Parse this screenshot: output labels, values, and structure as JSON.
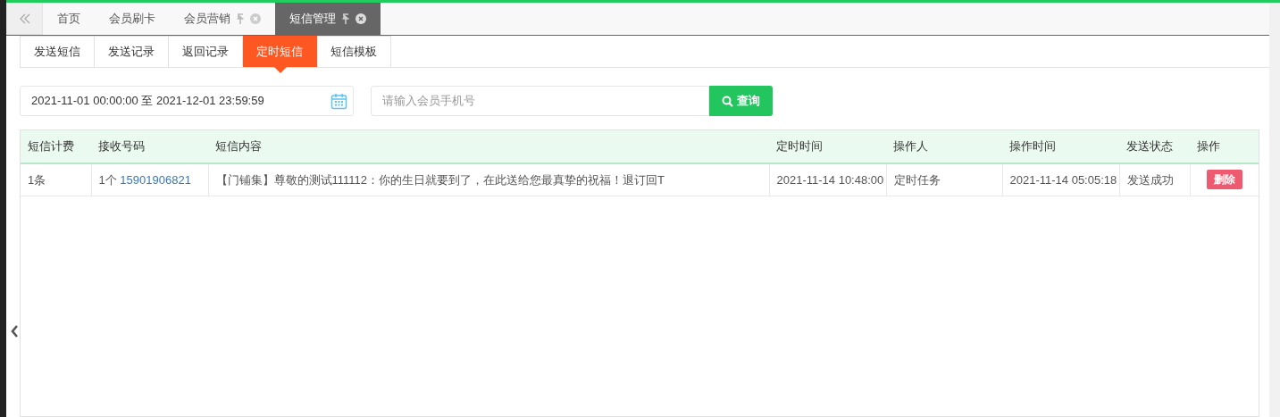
{
  "page_tabs": [
    {
      "label": "首页",
      "selected": false,
      "closable": false
    },
    {
      "label": "会员刷卡",
      "selected": false,
      "closable": false
    },
    {
      "label": "会员营销",
      "selected": false,
      "closable": true
    },
    {
      "label": "短信管理",
      "selected": true,
      "closable": true
    }
  ],
  "sub_tabs": [
    {
      "label": "发送短信",
      "selected": false
    },
    {
      "label": "发送记录",
      "selected": false
    },
    {
      "label": "返回记录",
      "selected": false
    },
    {
      "label": "定时短信",
      "selected": true
    },
    {
      "label": "短信模板",
      "selected": false
    }
  ],
  "filters": {
    "date_range": "2021-11-01 00:00:00 至 2021-12-01 23:59:59",
    "phone_placeholder": "请输入会员手机号",
    "search_button": "查询"
  },
  "table": {
    "columns": [
      "短信计费",
      "接收号码",
      "短信内容",
      "定时时间",
      "操作人",
      "操作时间",
      "发送状态",
      "操作"
    ],
    "rows": [
      {
        "billing": "1条",
        "count": "1个",
        "phone": "15901906821",
        "content": "【门铺集】尊敬的测试111112：你的生日就要到了，在此送给您最真挚的祝福！退订回T",
        "scheduled_time": "2021-11-14 10:48:00",
        "operator": "定时任务",
        "operation_time": "2021-11-14 05:05:18",
        "status": "发送成功",
        "action": "删除"
      }
    ]
  }
}
